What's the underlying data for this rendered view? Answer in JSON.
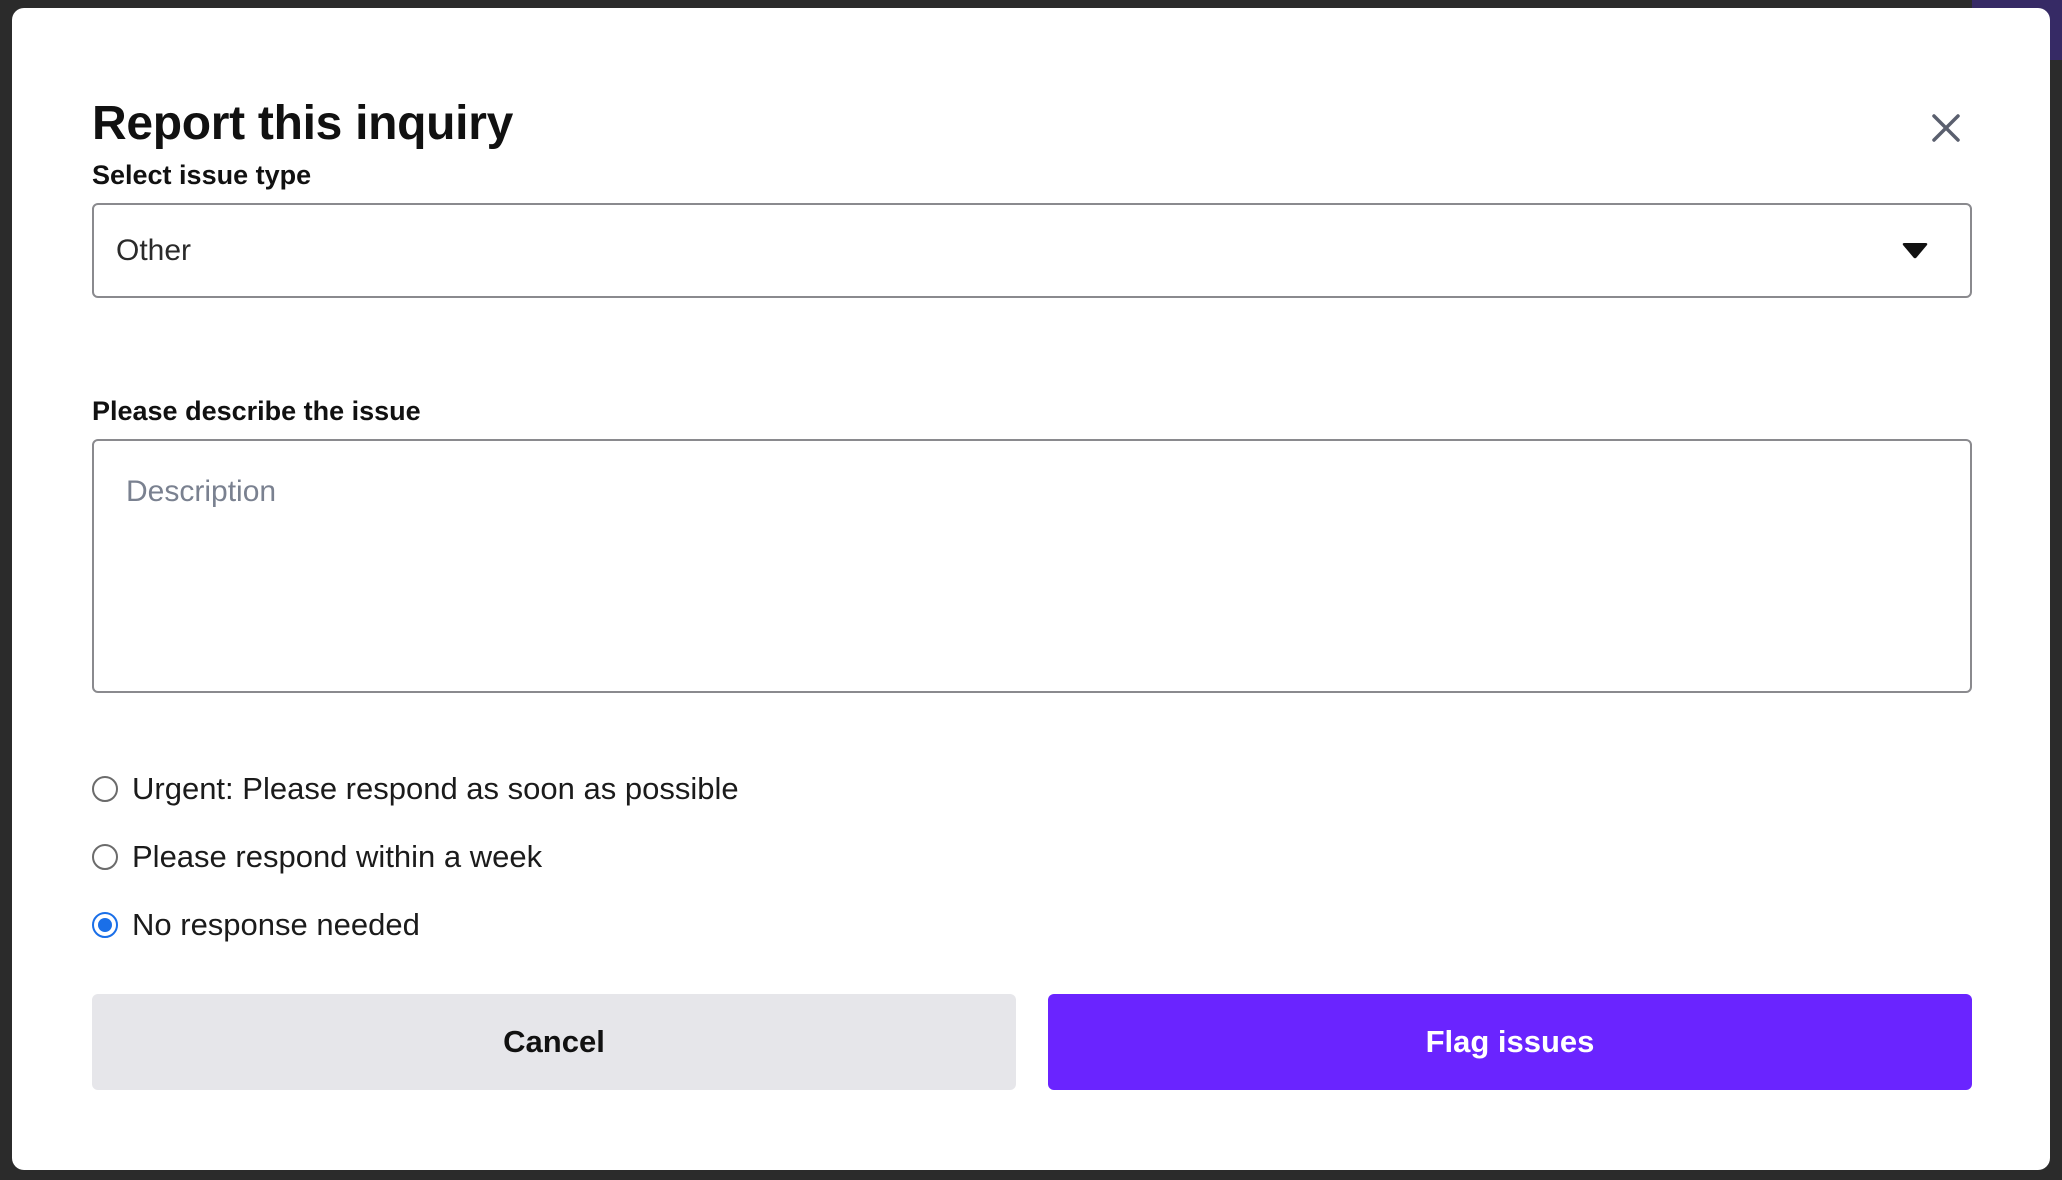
{
  "modal": {
    "title": "Report this inquiry",
    "close_icon": "close-icon"
  },
  "issue_type": {
    "label": "Select issue type",
    "selected": "Other",
    "caret_icon": "caret-down-icon"
  },
  "description": {
    "label": "Please describe the issue",
    "placeholder": "Description",
    "value": ""
  },
  "urgency": {
    "options": [
      {
        "label": "Urgent: Please respond as soon as possible",
        "checked": false
      },
      {
        "label": "Please respond within a week",
        "checked": false
      },
      {
        "label": "No response needed",
        "checked": true
      }
    ]
  },
  "actions": {
    "cancel_label": "Cancel",
    "submit_label": "Flag issues"
  },
  "colors": {
    "primary": "#6a24ff",
    "radio_checked": "#1a6fe8",
    "secondary_button": "#e6e6ea"
  }
}
